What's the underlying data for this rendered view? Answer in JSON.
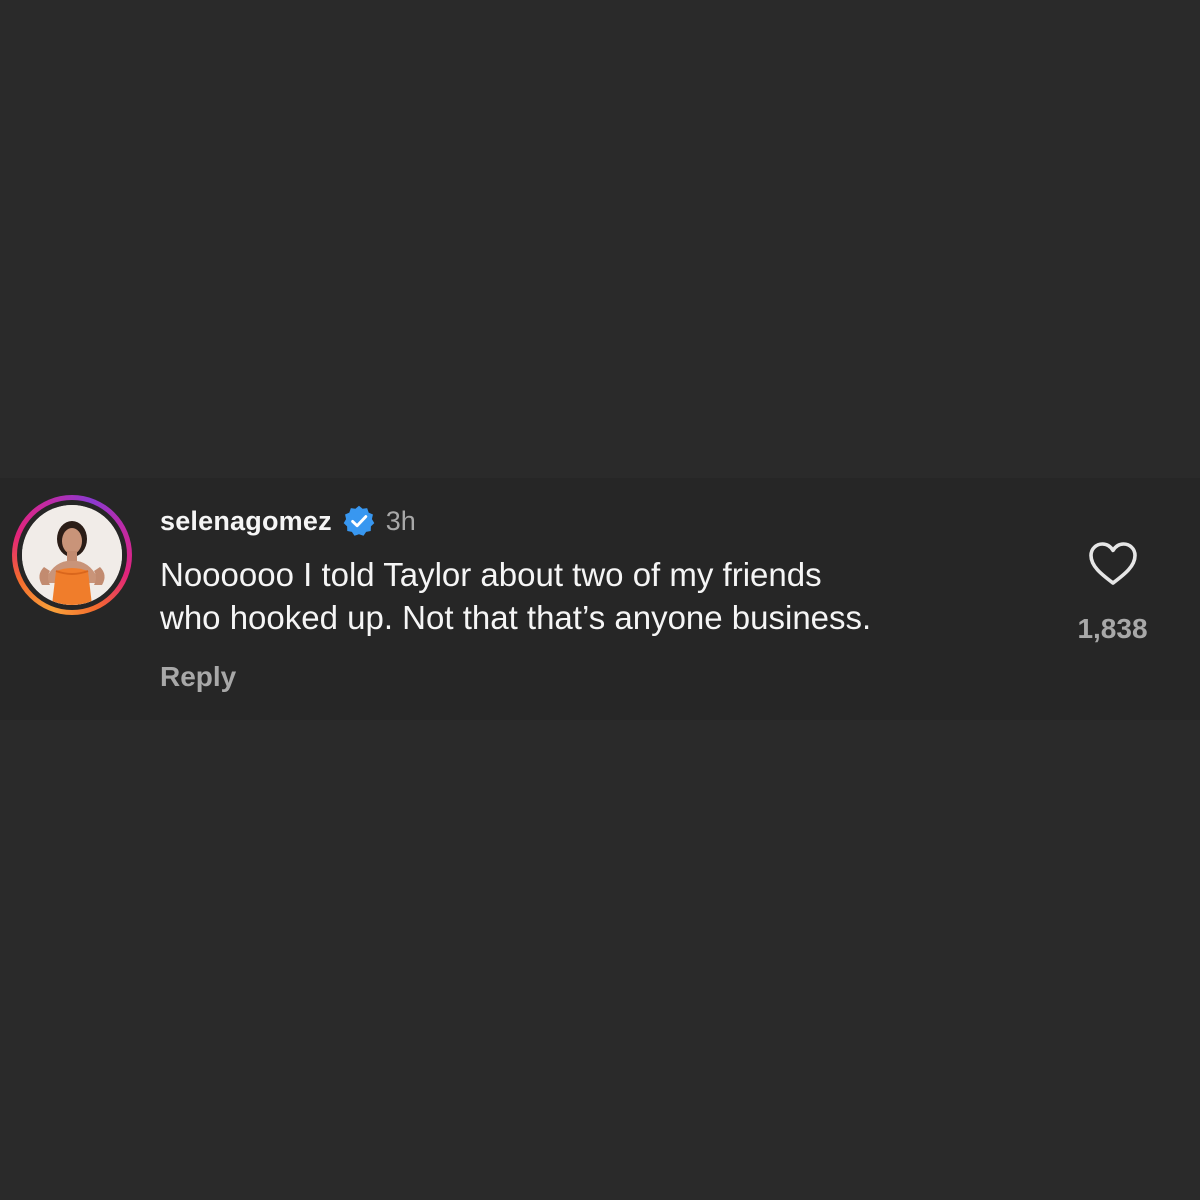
{
  "comment": {
    "username": "selenagomez",
    "verified": true,
    "timestamp": "3h",
    "text_lines": [
      "Noooooo I told Taylor about two of my friends",
      "who hooked up. Not that that’s anyone business."
    ],
    "reply_label": "Reply",
    "like_count": "1,838",
    "icons": {
      "verified": "verified-badge-icon",
      "like": "heart-outline-icon"
    }
  },
  "colors": {
    "background": "#2a2a2a",
    "card": "#262626",
    "primary_text": "#f5f5f5",
    "secondary_text": "#a8a8a8",
    "verified_blue": "#3897f0"
  }
}
